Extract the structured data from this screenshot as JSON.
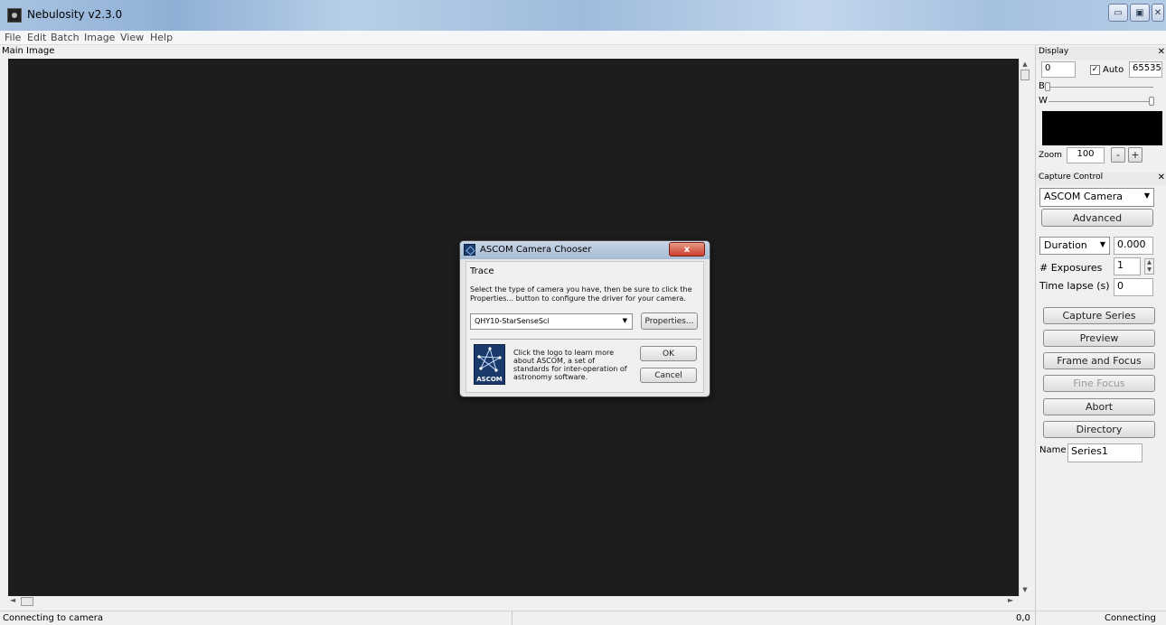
{
  "window": {
    "title": "Nebulosity v2.3.0",
    "min_glyph": "▭",
    "max_glyph": "▣",
    "close_glyph": "✕"
  },
  "menu": {
    "items": [
      "File",
      "Edit",
      "Batch",
      "Image",
      "View",
      "Help"
    ]
  },
  "main": {
    "label": "Main Image",
    "scroll_up": "▲",
    "scroll_down": "▼",
    "scroll_left": "◄",
    "scroll_right": "►"
  },
  "display_panel": {
    "title": "Display",
    "close": "✕",
    "black_value": "0",
    "auto_label": "Auto",
    "auto_checked": true,
    "white_value": "65535",
    "b_label": "B",
    "w_label": "W",
    "zoom_label": "Zoom",
    "zoom_value": "100",
    "zoom_out": "-",
    "zoom_in": "+"
  },
  "capture_panel": {
    "title": "Capture Control",
    "close": "✕",
    "camera": "ASCOM Camera",
    "advanced": "Advanced",
    "duration_label": "Duration",
    "duration_value": "0.000",
    "exposures_label": "# Exposures",
    "exposures_value": "1",
    "timelapse_label": "Time lapse (s)",
    "timelapse_value": "0",
    "capture_series": "Capture Series",
    "preview": "Preview",
    "frame_focus": "Frame and Focus",
    "fine_focus": "Fine Focus",
    "abort": "Abort",
    "directory": "Directory",
    "name_label": "Name",
    "name_value": "Series1"
  },
  "status": {
    "text": "Connecting to camera",
    "coords": "0,0",
    "connection": "Connecting"
  },
  "dialog": {
    "title": "ASCOM Camera Chooser",
    "close": "x",
    "trace": "Trace",
    "instructions": "Select the type of camera you have, then be sure to click the Properties... button to configure the driver for your camera.",
    "camera_selected": "QHY10-StarSenseSci",
    "properties": "Properties...",
    "logo_text": "ASCOM",
    "blurb": "Click the logo to learn more about ASCOM, a set of standards for inter-operation of astronomy software.",
    "ok": "OK",
    "cancel": "Cancel"
  },
  "icons": {
    "app": "nebulosity-app-icon",
    "dialog": "ascom-icon"
  },
  "colors": {
    "canvas": "#1d1d1d",
    "close_red": "#c9402a",
    "logo_blue": "#1a3a6c"
  }
}
